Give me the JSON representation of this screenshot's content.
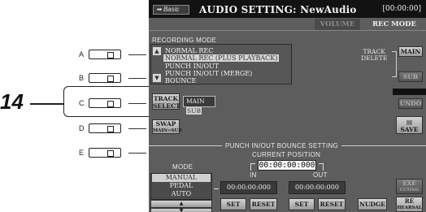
{
  "callout": {
    "number": "14"
  },
  "side_buttons": [
    {
      "letter": "A"
    },
    {
      "letter": "B"
    },
    {
      "letter": "C"
    },
    {
      "letter": "D"
    },
    {
      "letter": "E"
    }
  ],
  "header": {
    "basic_label": "Basic",
    "title": "AUDIO SETTING: NewAudio",
    "time": "[00:00:00]"
  },
  "tabs": [
    {
      "label": "VOLUME",
      "selected": false
    },
    {
      "label": "REC MODE",
      "selected": true
    }
  ],
  "recording_mode": {
    "header": "RECORDING MODE",
    "items": [
      "NORMAL REC",
      "NORMAL REC (PLUS PLAYBACK)",
      "PUNCH IN/OUT",
      "PUNCH IN/OUT (MERGE)",
      "BOUNCE"
    ],
    "selected_index": 1
  },
  "track_select": {
    "label_line1": "TRACK",
    "label_line2": "SELECT",
    "main": "MAIN",
    "sub": "SUB"
  },
  "swap": {
    "line1": "SWAP",
    "line2": "MAIN↔SUB"
  },
  "track_delete": {
    "label_line1": "TRACK",
    "label_line2": "DELETE",
    "main": "MAIN",
    "sub": "SUB"
  },
  "undo_label": "UNDO",
  "save_label": "SAVE",
  "punch": {
    "header": "PUNCH IN/OUT BOUNCE SETTING",
    "current_position_label": "CURRENT POSITION",
    "current_position": "00:00:00:000",
    "in_label": "IN",
    "out_label": "OUT",
    "mode_label": "MODE",
    "mode_items": [
      "MANUAL",
      "PEDAL",
      "AUTO"
    ],
    "mode_selected": 0,
    "in_time": "00:00:00:000",
    "out_time": "00:00:00:000",
    "set_in": "SET",
    "reset_in": "RESET",
    "set_out": "SET",
    "reset_out": "RESET",
    "nudge": "NUDGE",
    "exe_line1": "EXE",
    "exe_line2": "CUTING",
    "rehearsal_line1": "RE",
    "rehearsal_line2": "HEARSAL"
  }
}
